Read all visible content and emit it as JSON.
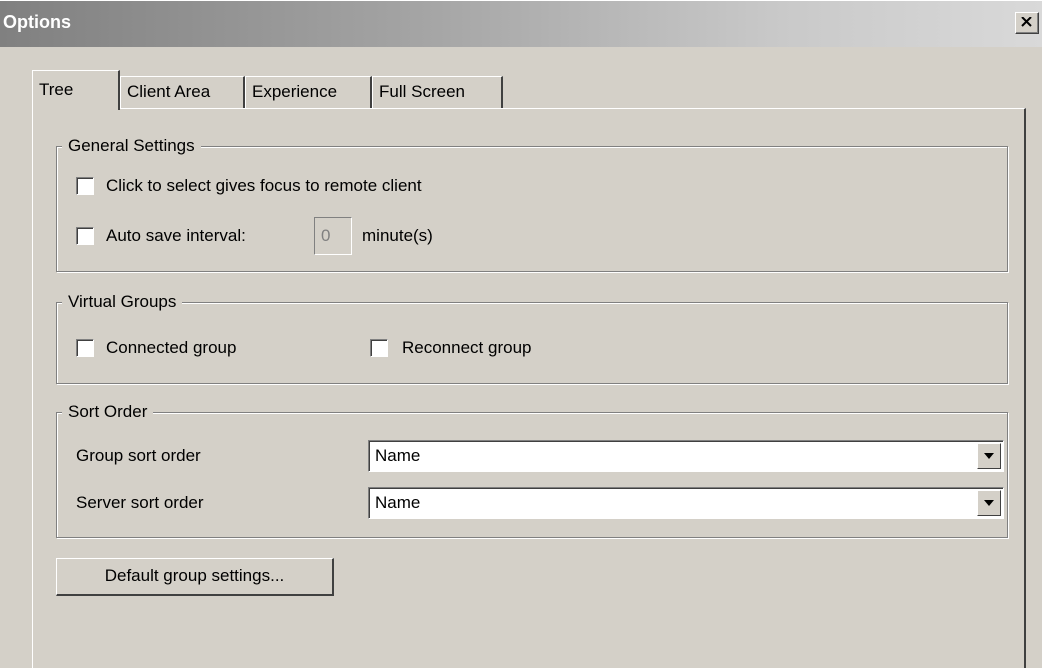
{
  "window": {
    "title": "Options"
  },
  "tabs": [
    {
      "label": "Tree",
      "active": true
    },
    {
      "label": "Client Area",
      "active": false
    },
    {
      "label": "Experience",
      "active": false
    },
    {
      "label": "Full Screen",
      "active": false
    }
  ],
  "general_settings": {
    "legend": "General Settings",
    "click_to_select": {
      "label": "Click to select gives focus to remote client",
      "checked": false
    },
    "auto_save": {
      "label": "Auto save interval:",
      "checked": false,
      "value": "0",
      "unit": "minute(s)"
    }
  },
  "virtual_groups": {
    "legend": "Virtual Groups",
    "connected": {
      "label": "Connected group",
      "checked": false
    },
    "reconnect": {
      "label": "Reconnect group",
      "checked": false
    }
  },
  "sort_order": {
    "legend": "Sort Order",
    "group_sort": {
      "label": "Group sort order",
      "value": "Name"
    },
    "server_sort": {
      "label": "Server sort order",
      "value": "Name"
    }
  },
  "default_group_button": {
    "label": "Default group settings..."
  },
  "icons": {
    "close": "close-icon",
    "dropdown": "chevron-down-icon"
  }
}
